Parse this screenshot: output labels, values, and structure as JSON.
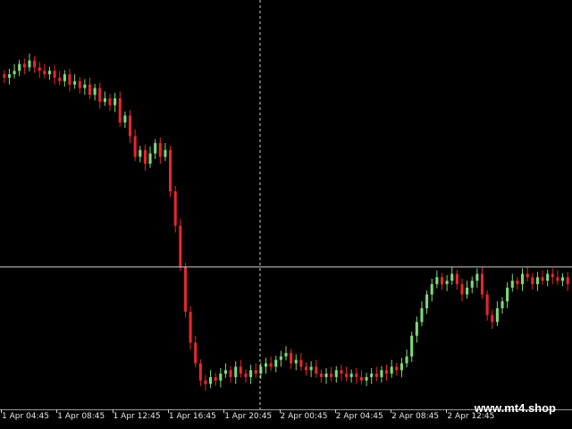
{
  "watermark": "www.mt4.shop",
  "colors": {
    "background": "#000000",
    "bull": "#7dd97a",
    "bear": "#e8262a",
    "crosshair": "#cfcfcf",
    "axis_text": "#e6e6e6"
  },
  "chart_data": {
    "type": "candlestick",
    "time_labels": [
      "1 Apr 04:45",
      "1 Apr 08:45",
      "1 Apr 12:45",
      "1 Apr 16:45",
      "1 Apr 20:45",
      "2 Apr 00:45",
      "2 Apr 04:45",
      "2 Apr 08:45",
      "2 Apr 12:45"
    ],
    "crosshair": {
      "time": "1 Apr 20:45",
      "price_level": 0.38
    },
    "closes": [
      0.93,
      0.94,
      0.95,
      0.97,
      0.96,
      0.98,
      0.96,
      0.95,
      0.94,
      0.95,
      0.93,
      0.92,
      0.94,
      0.91,
      0.92,
      0.9,
      0.91,
      0.88,
      0.9,
      0.86,
      0.87,
      0.85,
      0.87,
      0.8,
      0.82,
      0.76,
      0.7,
      0.72,
      0.68,
      0.71,
      0.74,
      0.7,
      0.72,
      0.6,
      0.5,
      0.38,
      0.25,
      0.16,
      0.1,
      0.05,
      0.04,
      0.06,
      0.05,
      0.07,
      0.08,
      0.06,
      0.09,
      0.07,
      0.06,
      0.08,
      0.07,
      0.09,
      0.1,
      0.09,
      0.11,
      0.12,
      0.13,
      0.1,
      0.11,
      0.09,
      0.08,
      0.09,
      0.07,
      0.06,
      0.07,
      0.06,
      0.08,
      0.07,
      0.06,
      0.07,
      0.06,
      0.05,
      0.06,
      0.07,
      0.06,
      0.08,
      0.07,
      0.09,
      0.08,
      0.1,
      0.12,
      0.18,
      0.22,
      0.26,
      0.3,
      0.33,
      0.35,
      0.33,
      0.34,
      0.36,
      0.33,
      0.3,
      0.32,
      0.34,
      0.36,
      0.3,
      0.24,
      0.22,
      0.26,
      0.28,
      0.32,
      0.34,
      0.33,
      0.36,
      0.35,
      0.33,
      0.35,
      0.34,
      0.36,
      0.35,
      0.34,
      0.35,
      0.33
    ]
  }
}
